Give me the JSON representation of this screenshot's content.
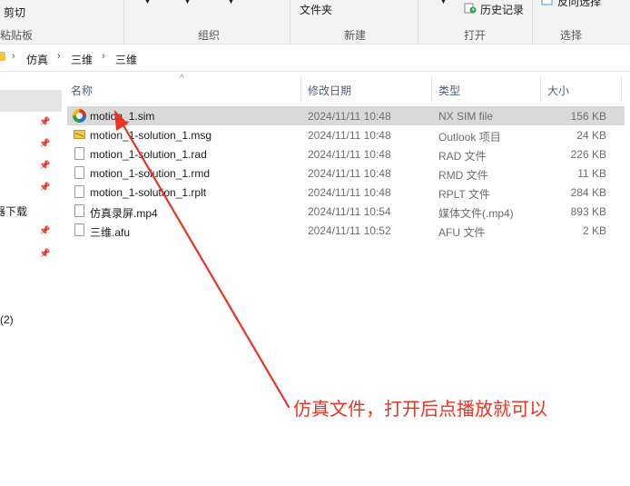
{
  "ribbon": {
    "clipboard": {
      "cut_label": "剪切",
      "paste_label": "粘贴板"
    },
    "organize_label": "组织",
    "new": {
      "new_folder_label": "文件夹",
      "group_label": "新建"
    },
    "open": {
      "history_label": "历史记录",
      "group_label": "打开"
    },
    "select": {
      "invert_label": "反向选择",
      "group_label": "选择"
    }
  },
  "breadcrumb": [
    "仿真",
    "三维",
    "三维"
  ],
  "nav": {
    "items": [
      "器下载",
      "(2)"
    ]
  },
  "columns": {
    "name": "名称",
    "date": "修改日期",
    "type": "类型",
    "size": "大小"
  },
  "files": [
    {
      "name": "motion_1.sim",
      "date": "2024/11/11 10:48",
      "type": "NX SIM file",
      "size": "156 KB",
      "icon": "nx-sim-icon",
      "selected": true
    },
    {
      "name": "motion_1-solution_1.msg",
      "date": "2024/11/11 10:48",
      "type": "Outlook 项目",
      "size": "24 KB",
      "icon": "mail-icon"
    },
    {
      "name": "motion_1-solution_1.rad",
      "date": "2024/11/11 10:48",
      "type": "RAD 文件",
      "size": "226 KB",
      "icon": "file-icon"
    },
    {
      "name": "motion_1-solution_1.rmd",
      "date": "2024/11/11 10:48",
      "type": "RMD 文件",
      "size": "11 KB",
      "icon": "file-icon"
    },
    {
      "name": "motion_1-solution_1.rplt",
      "date": "2024/11/11 10:48",
      "type": "RPLT 文件",
      "size": "284 KB",
      "icon": "file-icon"
    },
    {
      "name": "仿真录屏.mp4",
      "date": "2024/11/11 10:54",
      "type": "媒体文件(.mp4)",
      "size": "893 KB",
      "icon": "file-icon"
    },
    {
      "name": "三维.afu",
      "date": "2024/11/11 10:52",
      "type": "AFU 文件",
      "size": "2 KB",
      "icon": "file-icon"
    }
  ],
  "annotation": {
    "text": "仿真文件，打开后点播放就可以",
    "color": "#ea3323"
  }
}
